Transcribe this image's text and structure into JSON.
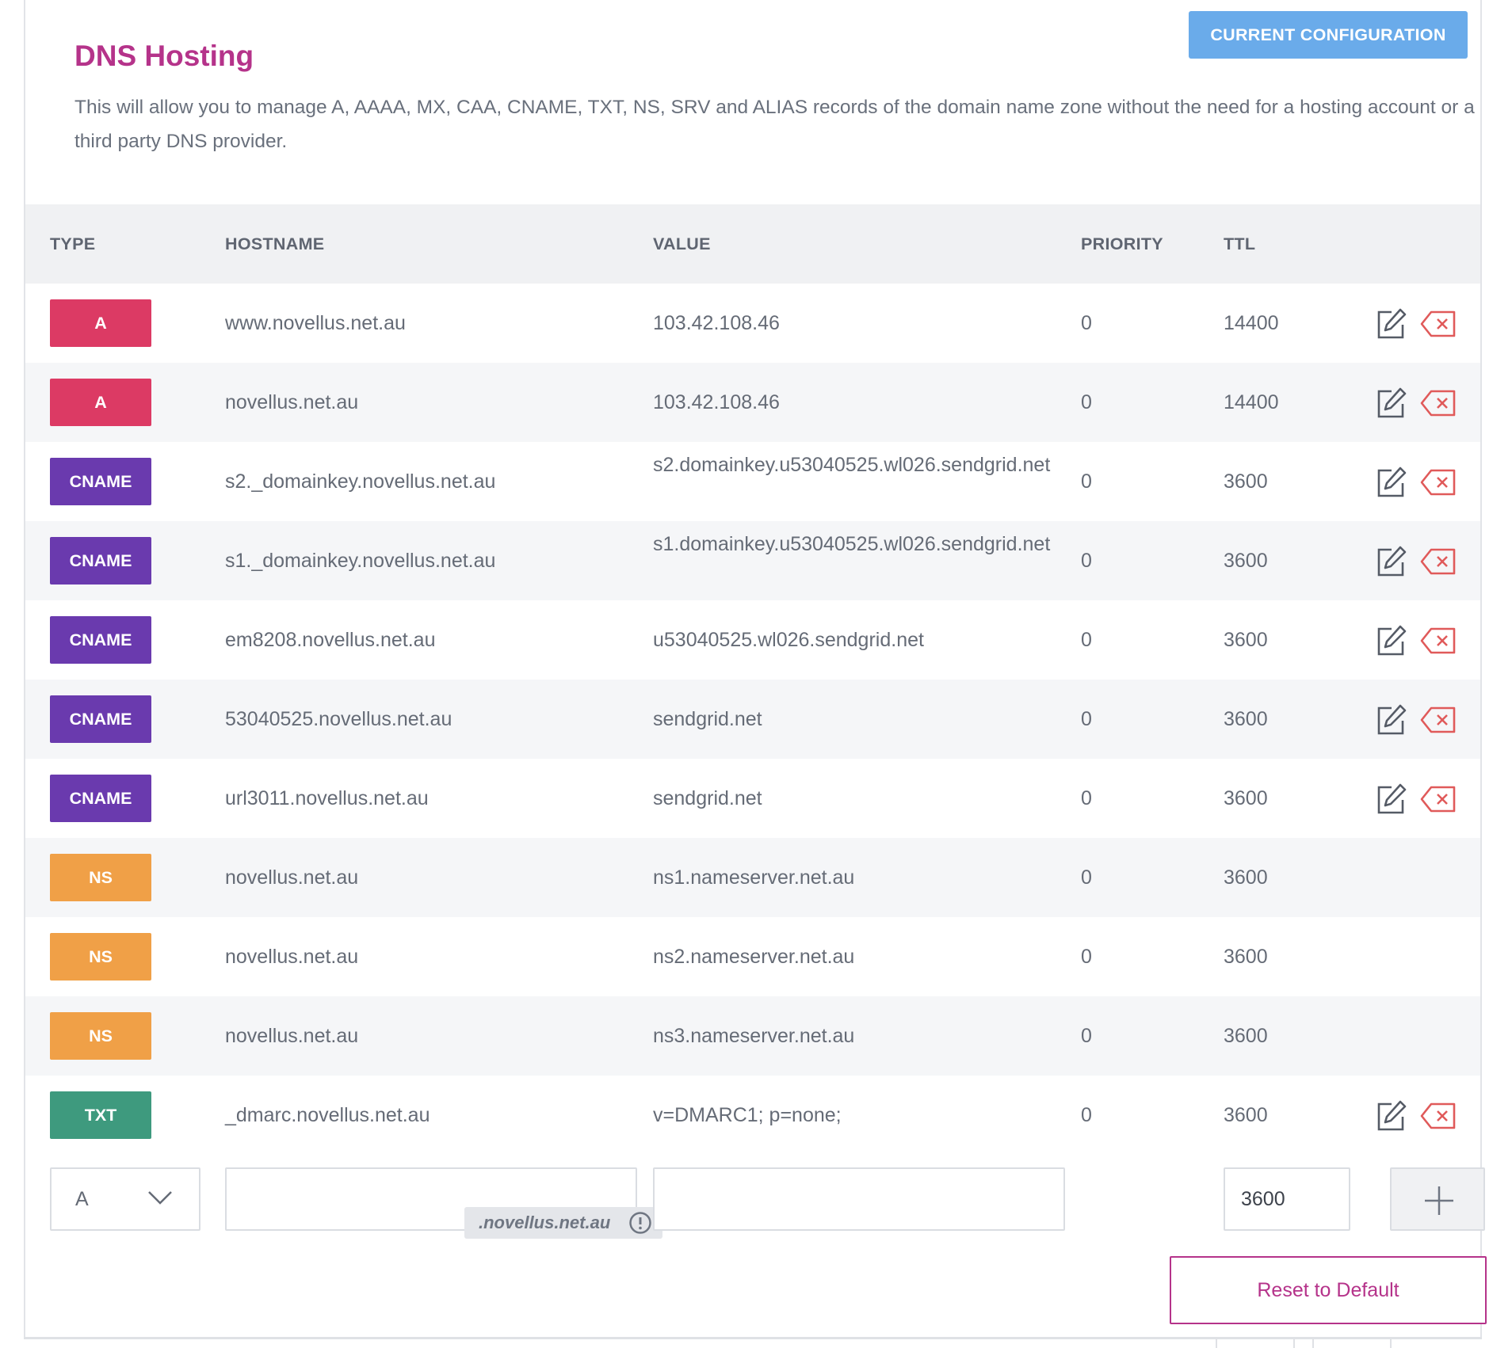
{
  "header": {
    "title": "DNS Hosting",
    "description": "This will allow you to manage A, AAAA, MX, CAA, CNAME, TXT, NS, SRV and ALIAS records of the domain name zone without the need for a hosting account or a third party DNS provider.",
    "current_config_label": "CURRENT CONFIGURATION"
  },
  "table": {
    "columns": {
      "type": "TYPE",
      "hostname": "HOSTNAME",
      "value": "VALUE",
      "priority": "PRIORITY",
      "ttl": "TTL"
    },
    "rows": [
      {
        "type": "A",
        "hostname": "www.novellus.net.au",
        "value": "103.42.108.46",
        "priority": "0",
        "ttl": "14400",
        "actions": true
      },
      {
        "type": "A",
        "hostname": "novellus.net.au",
        "value": "103.42.108.46",
        "priority": "0",
        "ttl": "14400",
        "actions": true
      },
      {
        "type": "CNAME",
        "hostname": "s2._domainkey.novellus.net.au",
        "value": "s2.domainkey.u53040525.wl026.sendgrid.net",
        "priority": "0",
        "ttl": "3600",
        "actions": true
      },
      {
        "type": "CNAME",
        "hostname": "s1._domainkey.novellus.net.au",
        "value": "s1.domainkey.u53040525.wl026.sendgrid.net",
        "priority": "0",
        "ttl": "3600",
        "actions": true
      },
      {
        "type": "CNAME",
        "hostname": "em8208.novellus.net.au",
        "value": "u53040525.wl026.sendgrid.net",
        "priority": "0",
        "ttl": "3600",
        "actions": true
      },
      {
        "type": "CNAME",
        "hostname": "53040525.novellus.net.au",
        "value": "sendgrid.net",
        "priority": "0",
        "ttl": "3600",
        "actions": true
      },
      {
        "type": "CNAME",
        "hostname": "url3011.novellus.net.au",
        "value": "sendgrid.net",
        "priority": "0",
        "ttl": "3600",
        "actions": true
      },
      {
        "type": "NS",
        "hostname": "novellus.net.au",
        "value": "ns1.nameserver.net.au",
        "priority": "0",
        "ttl": "3600",
        "actions": false
      },
      {
        "type": "NS",
        "hostname": "novellus.net.au",
        "value": "ns2.nameserver.net.au",
        "priority": "0",
        "ttl": "3600",
        "actions": false
      },
      {
        "type": "NS",
        "hostname": "novellus.net.au",
        "value": "ns3.nameserver.net.au",
        "priority": "0",
        "ttl": "3600",
        "actions": false
      },
      {
        "type": "TXT",
        "hostname": "_dmarc.novellus.net.au",
        "value": "v=DMARC1; p=none;",
        "priority": "0",
        "ttl": "3600",
        "actions": true
      }
    ]
  },
  "badge_colors": {
    "A": "#dc3a64",
    "CNAME": "#6a3aae",
    "NS": "#f0a047",
    "TXT": "#3e9a7e"
  },
  "icon_names": {
    "edit": "edit-icon",
    "delete": "delete-icon",
    "add": "plus-icon",
    "select": "chevron-down-icon",
    "warning": "exclamation-circle-icon"
  },
  "new_record": {
    "type_value": "A",
    "hostname_value": "",
    "hostname_suffix": ".novellus.net.au",
    "value_value": "",
    "ttl_value": "3600"
  },
  "reset_label": "Reset to Default",
  "colors": {
    "accent": "#b5338a",
    "button_blue": "#6aabea",
    "delete_red": "#e05a5a"
  }
}
